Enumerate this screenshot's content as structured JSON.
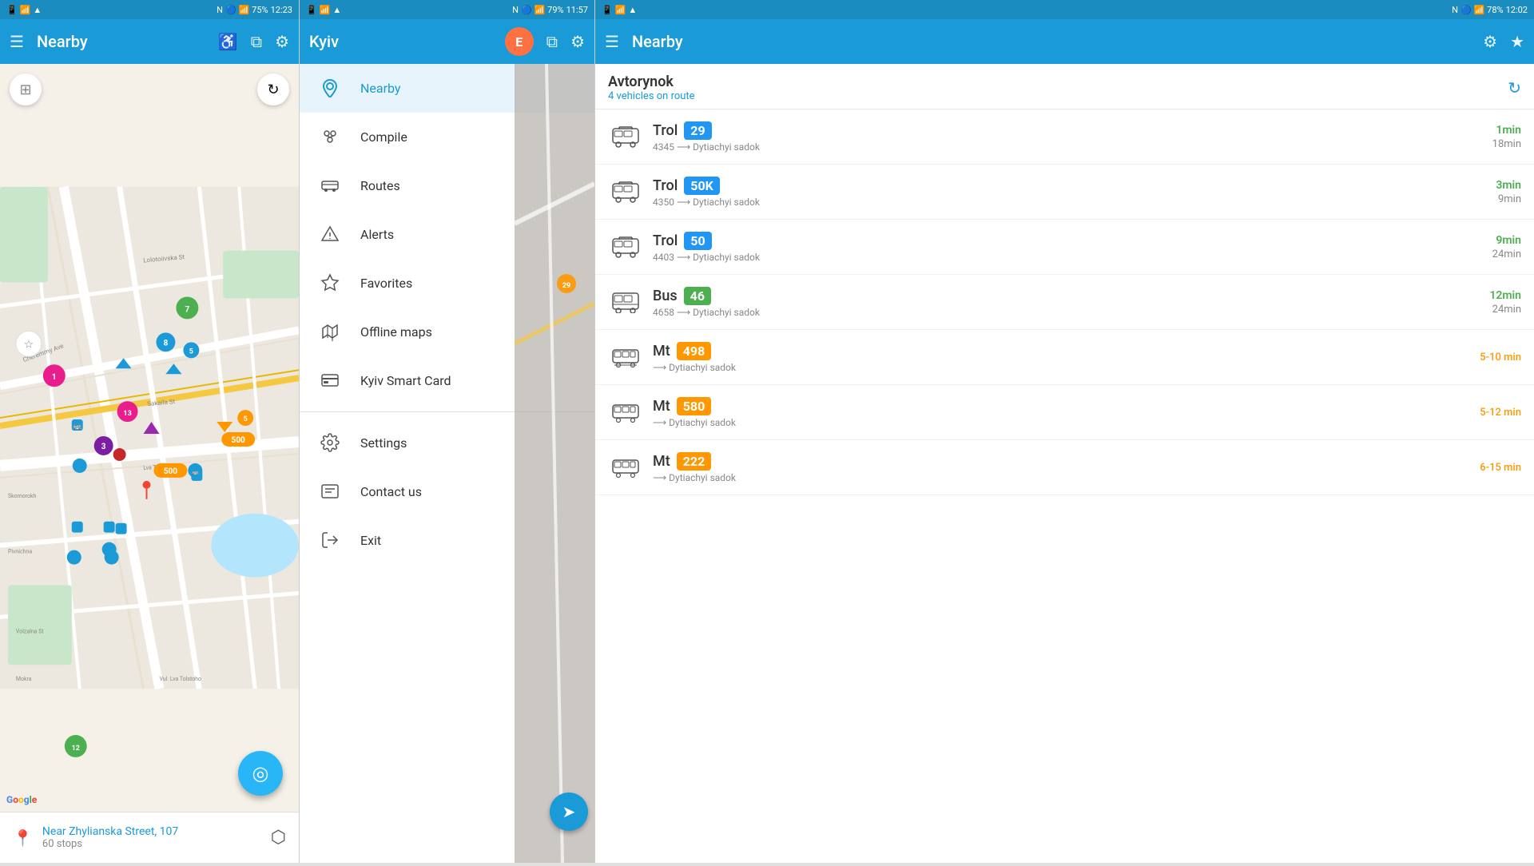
{
  "panel1": {
    "status_bar": {
      "left": "📶 75%",
      "time": "12:23"
    },
    "app_bar": {
      "title": "Nearby",
      "menu_icon": "☰",
      "accessibility_icon": "♿",
      "layers_icon": "⧉",
      "filter_icon": "⚙"
    },
    "map": {
      "refresh_label": "↻",
      "layers_label": "⚙",
      "fab_label": "◎"
    },
    "bottom_bar": {
      "street_label": "Near",
      "street_name": "Zhylianska Street, 107",
      "stops_count": "60 stops"
    }
  },
  "panel2": {
    "status_bar": {
      "left": "📶 79%",
      "time": "11:57"
    },
    "app_bar": {
      "title": "Kyiv",
      "user_icon": "E",
      "layers_icon": "⧉",
      "filter_icon": "⚙"
    },
    "menu_items": [
      {
        "id": "nearby",
        "label": "Nearby",
        "icon": "📍",
        "active": true
      },
      {
        "id": "compile",
        "label": "Compile",
        "icon": "⬡"
      },
      {
        "id": "routes",
        "label": "Routes",
        "icon": "🚌"
      },
      {
        "id": "alerts",
        "label": "Alerts",
        "icon": "⚠"
      },
      {
        "id": "favorites",
        "label": "Favorites",
        "icon": "☆"
      },
      {
        "id": "offline",
        "label": "Offline maps",
        "icon": "🗺"
      },
      {
        "id": "card",
        "label": "Kyiv Smart Card",
        "icon": "🪪"
      },
      {
        "id": "settings",
        "label": "Settings",
        "icon": "⚙"
      },
      {
        "id": "contact",
        "label": "Contact us",
        "icon": "💬"
      },
      {
        "id": "exit",
        "label": "Exit",
        "icon": "→"
      }
    ]
  },
  "panel3": {
    "status_bar": {
      "left": "📶 78%",
      "time": "12:02"
    },
    "app_bar": {
      "title": "Nearby",
      "menu_icon": "☰",
      "filter_icon": "⚙",
      "star_icon": "★"
    },
    "stop": {
      "name": "Avtorynok",
      "vehicles_count": "4 vehicles on route"
    },
    "vehicles": [
      {
        "type": "Trol",
        "route": "29",
        "badge_class": "badge-blue",
        "vehicle_type": "trol",
        "trip_id": "4345",
        "destination": "Dytiachyi sadok",
        "time1": "1min",
        "time2": "18min",
        "time_type": "numbered"
      },
      {
        "type": "Trol",
        "route": "50K",
        "badge_class": "badge-blue",
        "vehicle_type": "trol",
        "trip_id": "4350",
        "destination": "Dytiachyi sadok",
        "time1": "3min",
        "time2": "9min",
        "time_type": "numbered"
      },
      {
        "type": "Trol",
        "route": "50",
        "badge_class": "badge-blue",
        "vehicle_type": "trol",
        "trip_id": "4403",
        "destination": "Dytiachyi sadok",
        "time1": "9min",
        "time2": "24min",
        "time_type": "numbered"
      },
      {
        "type": "Bus",
        "route": "46",
        "badge_class": "badge-green",
        "vehicle_type": "bus",
        "trip_id": "4658",
        "destination": "Dytiachyi sadok",
        "time1": "12min",
        "time2": "24min",
        "time_type": "numbered"
      },
      {
        "type": "Mt",
        "route": "498",
        "badge_class": "badge-orange",
        "vehicle_type": "minibus",
        "trip_id": "",
        "destination": "Dytiachyi sadok",
        "time1": "5-10 min",
        "time2": "",
        "time_type": "range"
      },
      {
        "type": "Mt",
        "route": "580",
        "badge_class": "badge-orange",
        "vehicle_type": "minibus",
        "trip_id": "",
        "destination": "Dytiachyi sadok",
        "time1": "5-12 min",
        "time2": "",
        "time_type": "range"
      },
      {
        "type": "Mt",
        "route": "222",
        "badge_class": "badge-orange",
        "vehicle_type": "minibus",
        "trip_id": "",
        "destination": "Dytiachyi sadok",
        "time1": "6-15 min",
        "time2": "",
        "time_type": "range"
      }
    ]
  }
}
